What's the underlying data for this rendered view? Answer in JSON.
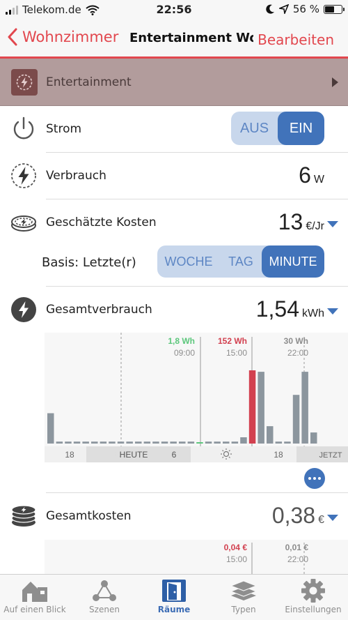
{
  "status_bar": {
    "carrier": "Telekom.de",
    "time": "22:56",
    "battery_percent": "56 %",
    "battery_level": 0.56
  },
  "nav": {
    "back_label": "Wohnzimmer",
    "title": "Entertainment Wo...",
    "edit_label": "Bearbeiten"
  },
  "category": {
    "label": "Entertainment",
    "color": "#b29c9c"
  },
  "power": {
    "label": "Strom",
    "off_label": "AUS",
    "on_label": "EIN",
    "state": "EIN"
  },
  "consumption": {
    "label": "Verbrauch",
    "value": "6",
    "unit": "W"
  },
  "estimated_cost": {
    "label": "Geschätzte Kosten",
    "value": "13",
    "unit": "€/Jr",
    "basis_label": "Basis: Letzte(r)",
    "basis_options": [
      "WOCHE",
      "TAG",
      "MINUTE"
    ],
    "basis_selected": "MINUTE"
  },
  "total_consumption": {
    "label": "Gesamtverbrauch",
    "value": "1,54",
    "unit": "kWh"
  },
  "total_cost": {
    "label": "Gesamtkosten",
    "value": "0,38",
    "unit": "€"
  },
  "chart_data": [
    {
      "type": "bar",
      "unit": "Wh",
      "annotations": [
        {
          "value": "1,8 Wh",
          "time": "09:00",
          "color": "#5cc77c"
        },
        {
          "value": "152 Wh",
          "time": "15:00",
          "color": "#d2404f"
        },
        {
          "value": "30 Wh",
          "time": "22:00",
          "color": "#8d8d8d"
        }
      ],
      "x_labels": [
        "18",
        "HEUTE",
        "6",
        "18",
        "JETZT"
      ],
      "values": [
        63,
        4,
        4,
        4,
        4,
        4,
        4,
        4,
        4,
        4,
        4,
        4,
        4,
        4,
        4,
        4,
        4,
        1.8,
        4,
        4,
        4,
        4,
        13,
        152,
        149,
        36,
        4,
        4,
        101,
        149,
        23
      ],
      "highlight_index": 23,
      "ylim": [
        0,
        152
      ]
    },
    {
      "type": "bar",
      "unit": "€",
      "annotations": [
        {
          "value": "0,04 €",
          "time": "15:00",
          "color": "#d2404f"
        },
        {
          "value": "0,01 €",
          "time": "22:00",
          "color": "#8d8d8d"
        }
      ]
    }
  ],
  "tabs": [
    {
      "label": "Auf einen Blick",
      "icon": "house-icon",
      "active": false
    },
    {
      "label": "Szenen",
      "icon": "scenes-icon",
      "active": false
    },
    {
      "label": "Räume",
      "icon": "door-icon",
      "active": true
    },
    {
      "label": "Typen",
      "icon": "layers-icon",
      "active": false
    },
    {
      "label": "Einstellungen",
      "icon": "gear-icon",
      "active": false
    }
  ],
  "colors": {
    "accent_red": "#e2474e",
    "accent_blue": "#4173ba",
    "segment_bg": "#c8d7ec"
  }
}
